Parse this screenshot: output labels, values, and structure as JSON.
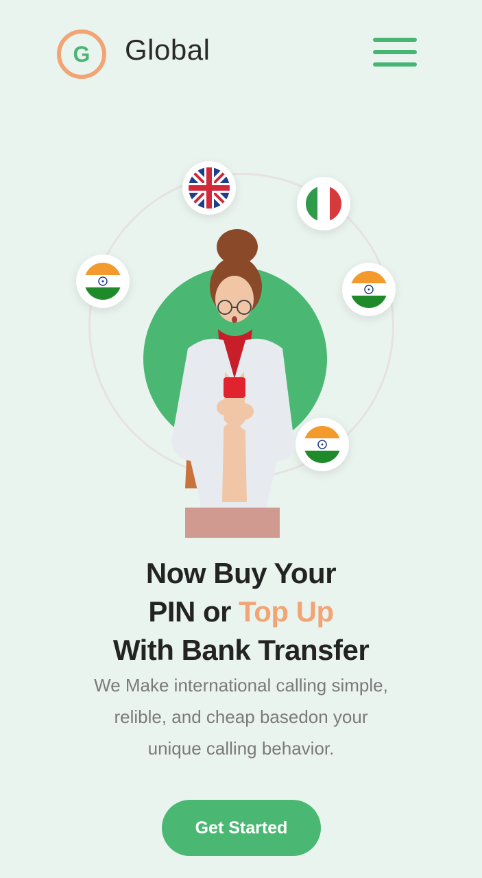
{
  "header": {
    "logo_letter": "G",
    "brand_name": "Global",
    "menu_icon": "hamburger-menu-icon"
  },
  "hero": {
    "flags": [
      {
        "name": "uk-flag-icon",
        "country": "United Kingdom"
      },
      {
        "name": "italy-flag-icon",
        "country": "Italy"
      },
      {
        "name": "india-flag-icon",
        "country": "India"
      },
      {
        "name": "india-flag-icon",
        "country": "India"
      },
      {
        "name": "india-flag-icon",
        "country": "India"
      }
    ]
  },
  "headline": {
    "line1": "Now Buy Your",
    "line2_prefix": "PIN or ",
    "line2_accent": "Top Up",
    "line3": "With Bank Transfer"
  },
  "subtext": {
    "line1": "We Make international calling simple,",
    "line2": "relible, and cheap basedon your",
    "line3": "unique calling behavior."
  },
  "cta": {
    "label": "Get Started"
  },
  "colors": {
    "background": "#eaf4ef",
    "brand_green": "#4ab873",
    "accent_orange": "#f2a474",
    "text_dark": "#232323",
    "text_muted": "#7a7a7a"
  }
}
